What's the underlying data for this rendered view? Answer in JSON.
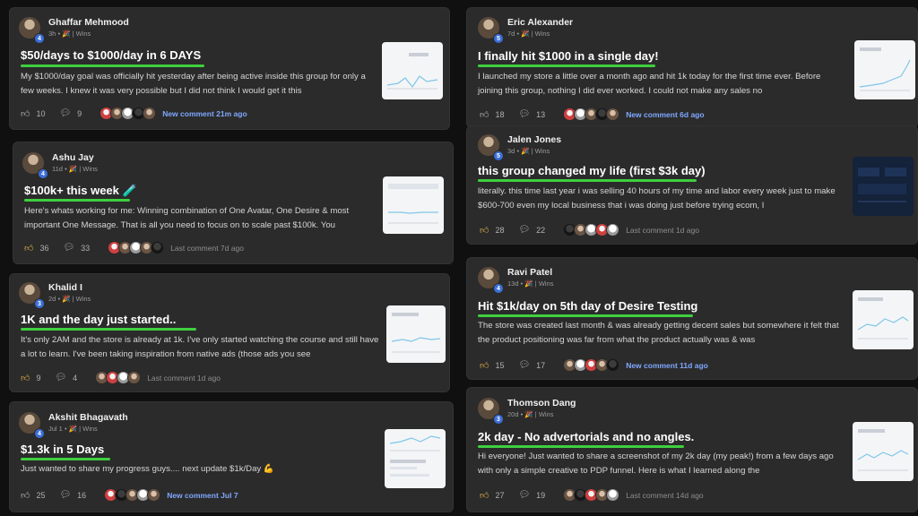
{
  "posts": [
    {
      "author": "Ghaffar Mehmood",
      "level": "4",
      "time": "3h",
      "category": "Wins",
      "title": "$50/days to $1000/day in 6 DAYS",
      "body": "My $1000/day goal was officially hit yesterday after being active inside this group for only a few weeks. I knew it was very possible but I did not think I would get it this",
      "likes": "10",
      "comments": "9",
      "activity": "New comment 21m ago",
      "activity_new": true,
      "liked": false
    },
    {
      "author": "Ashu Jay",
      "level": "4",
      "time": "11d",
      "category": "Wins",
      "title": "$100k+ this week 🧪",
      "body": "Here's whats working for me: Winning combination of One Avatar, One Desire & most important One Message. That is all you need to focus on to scale past $100k. You",
      "likes": "36",
      "comments": "33",
      "activity": "Last comment 7d ago",
      "activity_new": false,
      "liked": true
    },
    {
      "author": "Khalid I",
      "level": "3",
      "time": "2d",
      "category": "Wins",
      "title": "1K and the day just started..",
      "body": "It's only 2AM and the store is already at 1k. I've only started watching the course and still have a lot to learn. I've been taking inspiration from native ads (those ads you see",
      "likes": "9",
      "comments": "4",
      "activity": "Last comment 1d ago",
      "activity_new": false,
      "liked": true
    },
    {
      "author": "Akshit Bhagavath",
      "level": "4",
      "time": "Jul 1",
      "category": "Wins",
      "title": "$1.3k in 5 Days",
      "body": "Just wanted to share my progress guys.... next update $1k/Day 💪",
      "likes": "25",
      "comments": "16",
      "activity": "New comment Jul 7",
      "activity_new": true,
      "liked": false
    },
    {
      "author": "Eric Alexander",
      "level": "5",
      "time": "7d",
      "category": "Wins",
      "title": "I finally hit $1000 in a single day!",
      "body": "I launched my store a little over a month ago and hit 1k today for the first time ever. Before joining this group, nothing I did ever worked. I could not make any sales no",
      "likes": "18",
      "comments": "13",
      "activity": "New comment 6d ago",
      "activity_new": true,
      "liked": false
    },
    {
      "author": "Jalen Jones",
      "level": "5",
      "time": "3d",
      "category": "Wins",
      "title": "this group changed my life (first $3k day)",
      "body": "literally. this time last year i was selling 40 hours of my time and labor every week just to make $600-700 even my local business that i was doing just before trying ecom, I",
      "likes": "28",
      "comments": "22",
      "activity": "Last comment 1d ago",
      "activity_new": false,
      "liked": true
    },
    {
      "author": "Ravi Patel",
      "level": "4",
      "time": "13d",
      "category": "Wins",
      "title": "Hit $1k/day on 5th day of Desire Testing",
      "body": "The store was created last month & was already getting decent sales but somewhere it felt that the product positioning was far from what the product actually was & was",
      "likes": "15",
      "comments": "17",
      "activity": "New comment 11d ago",
      "activity_new": true,
      "liked": true
    },
    {
      "author": "Thomson Dang",
      "level": "3",
      "time": "20d",
      "category": "Wins",
      "title": "2k day - No advertorials and no angles.",
      "body": "Hi everyone! Just wanted to share a screenshot of my 2k day (my peak!) from a few days ago with only a simple creative to PDP funnel. Here is what I learned along the",
      "likes": "27",
      "comments": "19",
      "activity": "Last comment 14d ago",
      "activity_new": false,
      "liked": true
    }
  ],
  "separator": "•",
  "icons": {
    "like": "thumbs-up-icon",
    "comment": "comment-bubble-icon"
  },
  "colors": {
    "highlight": "#3fcf3f",
    "new_comment": "#7fa8ff",
    "level_badge": "#3b6fd8"
  }
}
